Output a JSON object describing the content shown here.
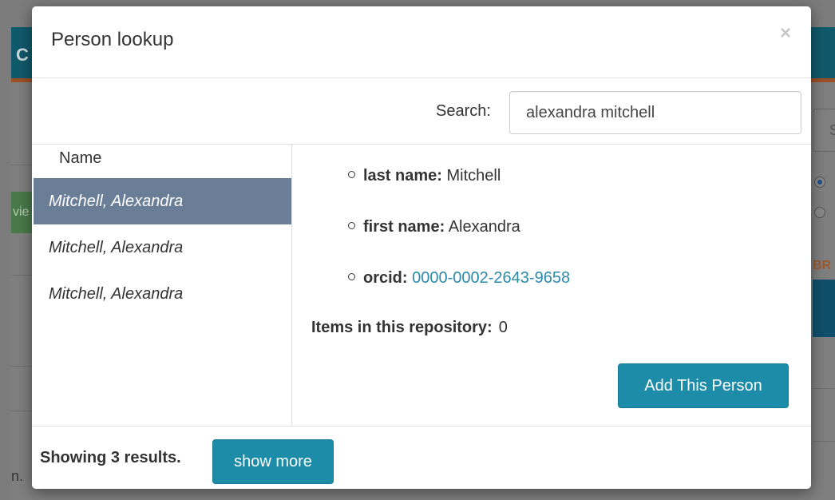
{
  "background": {
    "header_text": "C",
    "green_button_text": "vie",
    "right_input_text": "S",
    "orange_text": "BR",
    "footer_text": "n."
  },
  "modal": {
    "title": "Person lookup",
    "close_icon": "×"
  },
  "search": {
    "label": "Search:",
    "value": "alexandra mitchell"
  },
  "results": {
    "column_header": "Name",
    "items": [
      {
        "label": "Mitchell, Alexandra",
        "selected": true
      },
      {
        "label": "Mitchell, Alexandra",
        "selected": false
      },
      {
        "label": "Mitchell, Alexandra",
        "selected": false
      }
    ]
  },
  "details": {
    "last_name_label": "last name:",
    "last_name_value": "Mitchell",
    "first_name_label": "first name:",
    "first_name_value": "Alexandra",
    "orcid_label": "orcid:",
    "orcid_value": "0000-0002-2643-9658",
    "items_label": "Items in this repository:",
    "items_value": "0",
    "add_button_label": "Add This Person"
  },
  "footer": {
    "results_text": "Showing 3 results.",
    "show_more_label": "show more"
  },
  "colors": {
    "accent": "#1d8ca9",
    "selected_row": "#6b7e98",
    "link": "#2a8aa8"
  }
}
